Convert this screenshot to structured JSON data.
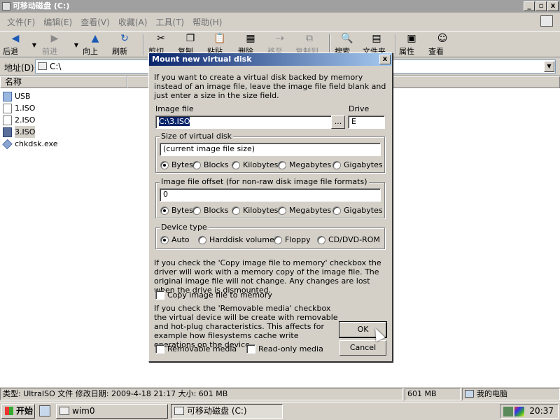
{
  "window": {
    "title": "可移动磁盘 (C:)",
    "btn_min": "_",
    "btn_max": "▫",
    "btn_close": "x"
  },
  "menu": {
    "items": [
      "文件(F)",
      "编辑(E)",
      "查看(V)",
      "收藏(A)",
      "工具(T)",
      "帮助(H)"
    ]
  },
  "toolbar": {
    "back": "后退",
    "forward": "前进",
    "up": "向上",
    "refresh": "刷新",
    "cut": "剪切",
    "copy": "复制",
    "paste": "粘贴",
    "delete": "删除",
    "move": "移至",
    "copyto": "复制到",
    "search": "搜索",
    "folders": "文件夹",
    "properties": "属性",
    "view": "查看"
  },
  "address": {
    "label": "地址(D)",
    "value": "C:\\"
  },
  "filepane": {
    "column_name": "名称",
    "files": [
      {
        "name": "USB",
        "type": "folder"
      },
      {
        "name": "1.ISO",
        "type": "iso"
      },
      {
        "name": "2.ISO",
        "type": "iso"
      },
      {
        "name": "3.ISO",
        "type": "iso",
        "selected": true
      },
      {
        "name": "chkdsk.exe",
        "type": "exe"
      }
    ]
  },
  "status": {
    "info": "类型: UltraISO 文件 修改日期: 2009-4-18 21:17 大小: 601 MB",
    "size": "601 MB",
    "location": "我的电脑"
  },
  "taskbar": {
    "start": "开始",
    "task1": "wim0",
    "task2": "可移动磁盘 (C:)",
    "time": "20:37"
  },
  "dialog": {
    "title": "Mount new virtual disk",
    "close": "x",
    "intro": "If you want to create a virtual disk backed by memory instead of an image file, leave the image file field blank and just enter a size in the size field.",
    "image_file_label": "Image file",
    "image_file_value": "C:\\3.ISO",
    "browse": "...",
    "drive_label": "Drive",
    "drive_value": "E",
    "size_group": "Size of virtual disk",
    "size_value": "(current image file size)",
    "offset_group": "Image file offset (for non-raw disk image file formats)",
    "offset_value": "0",
    "units": [
      "Bytes",
      "Blocks",
      "Kilobytes",
      "Megabytes",
      "Gigabytes"
    ],
    "device_group": "Device type",
    "device_types": [
      "Auto",
      "Harddisk volume",
      "Floppy",
      "CD/DVD-ROM"
    ],
    "copy_text": "If you check the 'Copy image file to memory' checkbox the driver will work with a memory copy of the image file. The original image file will not change. Any changes are lost when the drive is dismounted.",
    "copy_checkbox": "Copy image file to memory",
    "removable_text": "If you check the 'Removable media' checkbox the virtual device will be create with removable and hot-plug characteristics. This affects for example how filesystems cache write operations on the device.",
    "removable_checkbox": "Removable media",
    "readonly_checkbox": "Read-only media",
    "ok": "OK",
    "cancel": "Cancel"
  }
}
